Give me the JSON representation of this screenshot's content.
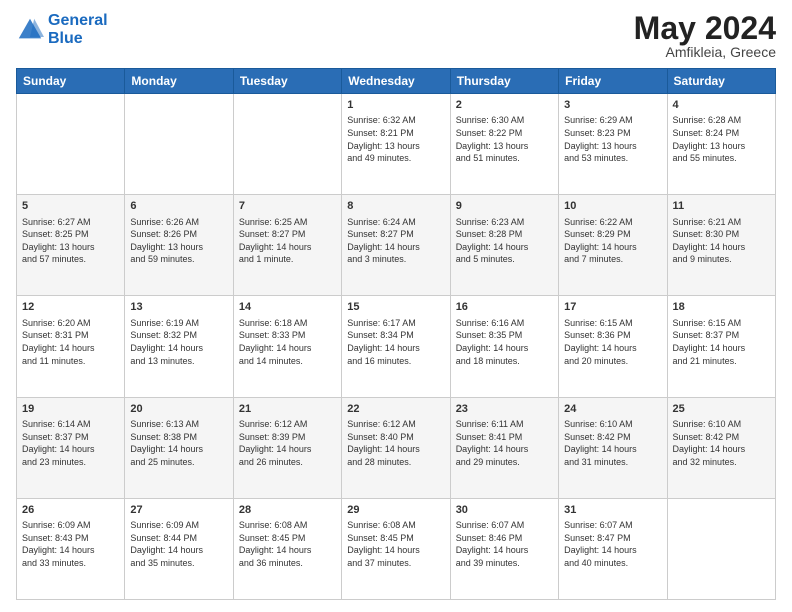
{
  "header": {
    "logo_line1": "General",
    "logo_line2": "Blue",
    "month_year": "May 2024",
    "location": "Amfikleia, Greece"
  },
  "days_of_week": [
    "Sunday",
    "Monday",
    "Tuesday",
    "Wednesday",
    "Thursday",
    "Friday",
    "Saturday"
  ],
  "weeks": [
    [
      {
        "day": "",
        "content": ""
      },
      {
        "day": "",
        "content": ""
      },
      {
        "day": "",
        "content": ""
      },
      {
        "day": "1",
        "content": "Sunrise: 6:32 AM\nSunset: 8:21 PM\nDaylight: 13 hours\nand 49 minutes."
      },
      {
        "day": "2",
        "content": "Sunrise: 6:30 AM\nSunset: 8:22 PM\nDaylight: 13 hours\nand 51 minutes."
      },
      {
        "day": "3",
        "content": "Sunrise: 6:29 AM\nSunset: 8:23 PM\nDaylight: 13 hours\nand 53 minutes."
      },
      {
        "day": "4",
        "content": "Sunrise: 6:28 AM\nSunset: 8:24 PM\nDaylight: 13 hours\nand 55 minutes."
      }
    ],
    [
      {
        "day": "5",
        "content": "Sunrise: 6:27 AM\nSunset: 8:25 PM\nDaylight: 13 hours\nand 57 minutes."
      },
      {
        "day": "6",
        "content": "Sunrise: 6:26 AM\nSunset: 8:26 PM\nDaylight: 13 hours\nand 59 minutes."
      },
      {
        "day": "7",
        "content": "Sunrise: 6:25 AM\nSunset: 8:27 PM\nDaylight: 14 hours\nand 1 minute."
      },
      {
        "day": "8",
        "content": "Sunrise: 6:24 AM\nSunset: 8:27 PM\nDaylight: 14 hours\nand 3 minutes."
      },
      {
        "day": "9",
        "content": "Sunrise: 6:23 AM\nSunset: 8:28 PM\nDaylight: 14 hours\nand 5 minutes."
      },
      {
        "day": "10",
        "content": "Sunrise: 6:22 AM\nSunset: 8:29 PM\nDaylight: 14 hours\nand 7 minutes."
      },
      {
        "day": "11",
        "content": "Sunrise: 6:21 AM\nSunset: 8:30 PM\nDaylight: 14 hours\nand 9 minutes."
      }
    ],
    [
      {
        "day": "12",
        "content": "Sunrise: 6:20 AM\nSunset: 8:31 PM\nDaylight: 14 hours\nand 11 minutes."
      },
      {
        "day": "13",
        "content": "Sunrise: 6:19 AM\nSunset: 8:32 PM\nDaylight: 14 hours\nand 13 minutes."
      },
      {
        "day": "14",
        "content": "Sunrise: 6:18 AM\nSunset: 8:33 PM\nDaylight: 14 hours\nand 14 minutes."
      },
      {
        "day": "15",
        "content": "Sunrise: 6:17 AM\nSunset: 8:34 PM\nDaylight: 14 hours\nand 16 minutes."
      },
      {
        "day": "16",
        "content": "Sunrise: 6:16 AM\nSunset: 8:35 PM\nDaylight: 14 hours\nand 18 minutes."
      },
      {
        "day": "17",
        "content": "Sunrise: 6:15 AM\nSunset: 8:36 PM\nDaylight: 14 hours\nand 20 minutes."
      },
      {
        "day": "18",
        "content": "Sunrise: 6:15 AM\nSunset: 8:37 PM\nDaylight: 14 hours\nand 21 minutes."
      }
    ],
    [
      {
        "day": "19",
        "content": "Sunrise: 6:14 AM\nSunset: 8:37 PM\nDaylight: 14 hours\nand 23 minutes."
      },
      {
        "day": "20",
        "content": "Sunrise: 6:13 AM\nSunset: 8:38 PM\nDaylight: 14 hours\nand 25 minutes."
      },
      {
        "day": "21",
        "content": "Sunrise: 6:12 AM\nSunset: 8:39 PM\nDaylight: 14 hours\nand 26 minutes."
      },
      {
        "day": "22",
        "content": "Sunrise: 6:12 AM\nSunset: 8:40 PM\nDaylight: 14 hours\nand 28 minutes."
      },
      {
        "day": "23",
        "content": "Sunrise: 6:11 AM\nSunset: 8:41 PM\nDaylight: 14 hours\nand 29 minutes."
      },
      {
        "day": "24",
        "content": "Sunrise: 6:10 AM\nSunset: 8:42 PM\nDaylight: 14 hours\nand 31 minutes."
      },
      {
        "day": "25",
        "content": "Sunrise: 6:10 AM\nSunset: 8:42 PM\nDaylight: 14 hours\nand 32 minutes."
      }
    ],
    [
      {
        "day": "26",
        "content": "Sunrise: 6:09 AM\nSunset: 8:43 PM\nDaylight: 14 hours\nand 33 minutes."
      },
      {
        "day": "27",
        "content": "Sunrise: 6:09 AM\nSunset: 8:44 PM\nDaylight: 14 hours\nand 35 minutes."
      },
      {
        "day": "28",
        "content": "Sunrise: 6:08 AM\nSunset: 8:45 PM\nDaylight: 14 hours\nand 36 minutes."
      },
      {
        "day": "29",
        "content": "Sunrise: 6:08 AM\nSunset: 8:45 PM\nDaylight: 14 hours\nand 37 minutes."
      },
      {
        "day": "30",
        "content": "Sunrise: 6:07 AM\nSunset: 8:46 PM\nDaylight: 14 hours\nand 39 minutes."
      },
      {
        "day": "31",
        "content": "Sunrise: 6:07 AM\nSunset: 8:47 PM\nDaylight: 14 hours\nand 40 minutes."
      },
      {
        "day": "",
        "content": ""
      }
    ]
  ]
}
